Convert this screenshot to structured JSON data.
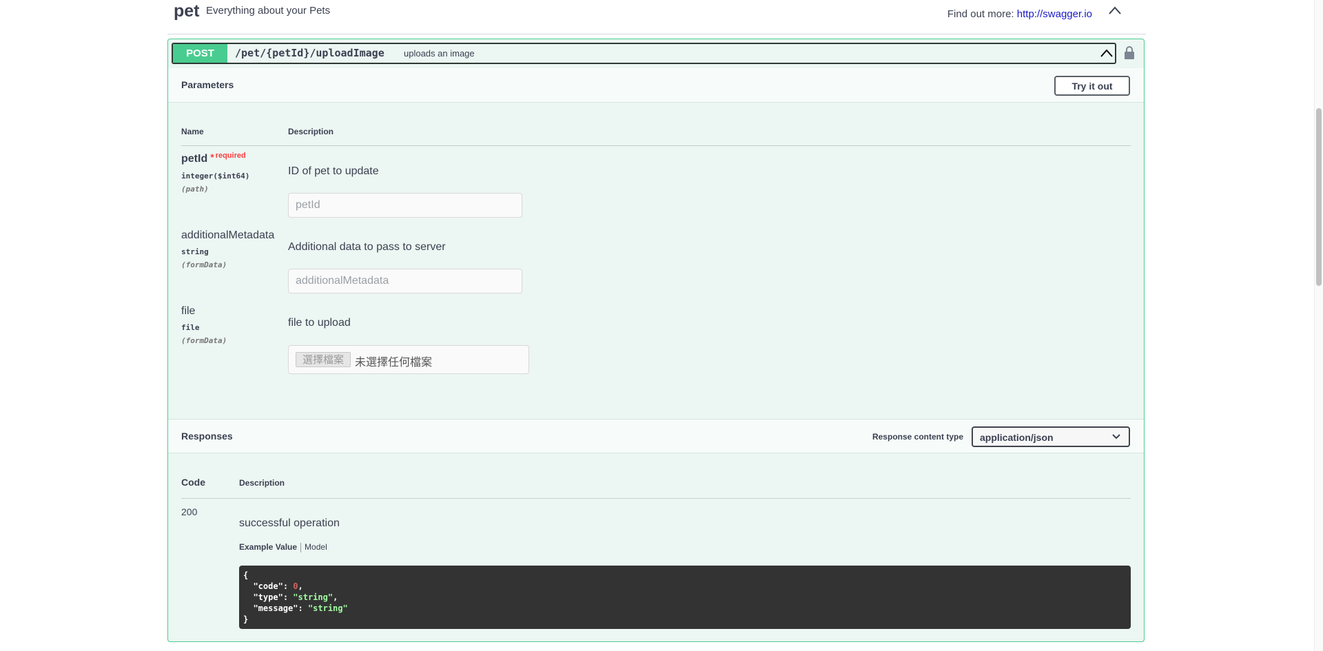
{
  "tag": {
    "name": "pet",
    "description": "Everything about your Pets",
    "find_more_label": "Find out more:",
    "find_more_link": "http://swagger.io"
  },
  "operation": {
    "method": "POST",
    "path": "/pet/{petId}/uploadImage",
    "summary": "uploads an image"
  },
  "parameters": {
    "section_title": "Parameters",
    "try_button": "Try it out",
    "col_name": "Name",
    "col_description": "Description",
    "required_star": "*",
    "required_label": "required",
    "items": [
      {
        "name": "petId",
        "type": "integer($int64)",
        "in": "(path)",
        "description": "ID of pet to update",
        "placeholder": "petId"
      },
      {
        "name": "additionalMetadata",
        "type": "string",
        "in": "(formData)",
        "description": "Additional data to pass to server",
        "placeholder": "additionalMetadata"
      },
      {
        "name": "file",
        "type": "file",
        "in": "(formData)",
        "description": "file to upload",
        "file_button": "選擇檔案",
        "file_status": "未選擇任何檔案"
      }
    ]
  },
  "responses": {
    "section_title": "Responses",
    "content_type_label": "Response content type",
    "content_type_value": "application/json",
    "col_code": "Code",
    "col_description": "Description",
    "items": [
      {
        "code": "200",
        "description": "successful operation",
        "tab_example": "Example Value",
        "tab_model": "Model",
        "example": {
          "open": "{",
          "code_key": "\"code\"",
          "code_val": "0",
          "type_key": "\"type\"",
          "type_val": "\"string\"",
          "message_key": "\"message\"",
          "message_val": "\"string\"",
          "close": "}"
        }
      }
    ]
  },
  "colors": {
    "post_green": "#49cc90",
    "opblock_bg": "#ecf6f2",
    "required_red": "#f93e3e",
    "code_bg": "#333333"
  }
}
